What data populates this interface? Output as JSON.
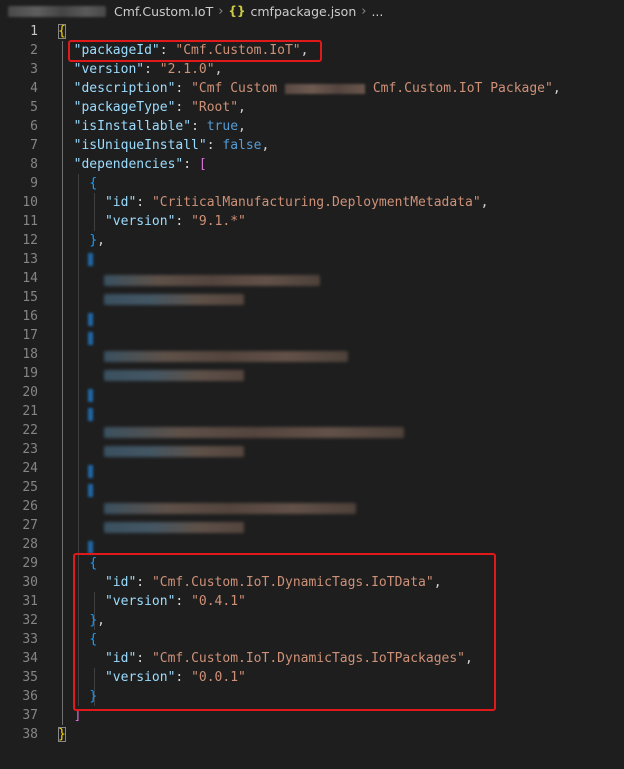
{
  "breadcrumb": {
    "folder": "Cmf.Custom.IoT",
    "file": "cmfpackage.json",
    "icon": "json-file-icon",
    "trailing": "..."
  },
  "editor": {
    "line_numbers": [
      "1",
      "2",
      "3",
      "4",
      "5",
      "6",
      "7",
      "8",
      "9",
      "10",
      "11",
      "12",
      "13",
      "14",
      "15",
      "16",
      "17",
      "18",
      "19",
      "20",
      "21",
      "22",
      "23",
      "24",
      "25",
      "26",
      "27",
      "28",
      "29",
      "30",
      "31",
      "32",
      "33",
      "34",
      "35",
      "36",
      "37",
      "38"
    ],
    "active_line": "1",
    "json": {
      "open_brace": "{",
      "close_brace": "}",
      "packageId_key": "\"packageId\"",
      "packageId_value": "\"Cmf.Custom.IoT\"",
      "version_key": "\"version\"",
      "version_value": "\"2.1.0\"",
      "description_key": "\"description\"",
      "description_value_start": "\"Cmf Custom",
      "description_value_end": "Cmf.Custom.IoT Package\"",
      "packageType_key": "\"packageType\"",
      "packageType_value": "\"Root\"",
      "isInstallable_key": "\"isInstallable\"",
      "isInstallable_value": "true",
      "isUniqueInstall_key": "\"isUniqueInstall\"",
      "isUniqueInstall_value": "false",
      "dependencies_key": "\"dependencies\"",
      "array_open": "[",
      "array_close": "]",
      "dep1": {
        "id_key": "\"id\"",
        "id_value": "\"CriticalManufacturing.DeploymentMetadata\"",
        "version_key": "\"version\"",
        "version_value": "\"9.1.*\""
      },
      "dep2": {
        "id_key": "\"id\"",
        "id_value": "\"Cmf.Custom.IoT.DynamicTags.IoTData\"",
        "version_key": "\"version\"",
        "version_value": "\"0.4.1\""
      },
      "dep3": {
        "id_key": "\"id\"",
        "id_value": "\"Cmf.Custom.IoT.DynamicTags.IoTPackages\"",
        "version_key": "\"version\"",
        "version_value": "\"0.0.1\""
      }
    }
  },
  "colors": {
    "background": "#1e1e1e",
    "key": "#9cdcfe",
    "string": "#ce9178",
    "boolean": "#569cd6",
    "bracket_level1": "#ffd700",
    "bracket_level2": "#da70d6",
    "bracket_level3": "#179fff",
    "highlight_box": "#e01a1a"
  }
}
